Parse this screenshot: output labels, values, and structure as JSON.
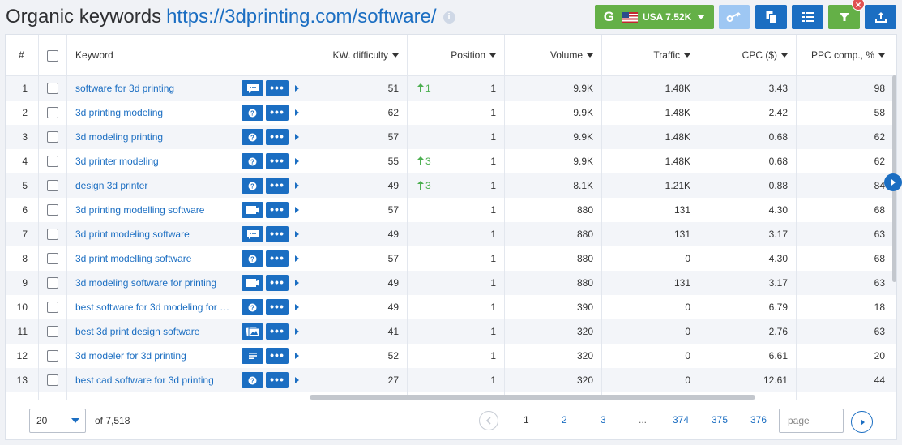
{
  "header": {
    "title": "Organic keywords",
    "url": "https://3dprinting.com/software/",
    "info_icon": "i",
    "database_label": "USA 7.52K",
    "database_g": "G"
  },
  "table": {
    "columns": {
      "index": "#",
      "keyword": "Keyword",
      "kd": "KW. difficulty",
      "position": "Position",
      "volume": "Volume",
      "traffic": "Traffic",
      "cpc": "CPC ($)",
      "ppc": "PPC comp., %"
    },
    "rows": [
      {
        "n": "1",
        "keyword": "software for 3d printing",
        "serp": "chat-bubble-icon",
        "kd": "51",
        "change": "1",
        "position": "1",
        "volume": "9.9K",
        "traffic": "1.48K",
        "cpc": "3.43",
        "ppc": "98"
      },
      {
        "n": "2",
        "keyword": "3d printing modeling",
        "serp": "question-icon",
        "kd": "62",
        "change": "",
        "position": "1",
        "volume": "9.9K",
        "traffic": "1.48K",
        "cpc": "2.42",
        "ppc": "58"
      },
      {
        "n": "3",
        "keyword": "3d modeling printing",
        "serp": "question-icon",
        "kd": "57",
        "change": "",
        "position": "1",
        "volume": "9.9K",
        "traffic": "1.48K",
        "cpc": "0.68",
        "ppc": "62"
      },
      {
        "n": "4",
        "keyword": "3d printer modeling",
        "serp": "question-icon",
        "kd": "55",
        "change": "3",
        "position": "1",
        "volume": "9.9K",
        "traffic": "1.48K",
        "cpc": "0.68",
        "ppc": "62"
      },
      {
        "n": "5",
        "keyword": "design 3d printer",
        "serp": "question-icon",
        "kd": "49",
        "change": "3",
        "position": "1",
        "volume": "8.1K",
        "traffic": "1.21K",
        "cpc": "0.88",
        "ppc": "84"
      },
      {
        "n": "6",
        "keyword": "3d printing modelling software",
        "serp": "video-icon",
        "kd": "57",
        "change": "",
        "position": "1",
        "volume": "880",
        "traffic": "131",
        "cpc": "4.30",
        "ppc": "68"
      },
      {
        "n": "7",
        "keyword": "3d print modeling software",
        "serp": "chat-bubble-icon",
        "kd": "49",
        "change": "",
        "position": "1",
        "volume": "880",
        "traffic": "131",
        "cpc": "3.17",
        "ppc": "63"
      },
      {
        "n": "8",
        "keyword": "3d print modelling software",
        "serp": "question-icon",
        "kd": "57",
        "change": "",
        "position": "1",
        "volume": "880",
        "traffic": "0",
        "cpc": "4.30",
        "ppc": "68"
      },
      {
        "n": "9",
        "keyword": "3d modeling software for printing",
        "serp": "video-icon",
        "kd": "49",
        "change": "",
        "position": "1",
        "volume": "880",
        "traffic": "131",
        "cpc": "3.17",
        "ppc": "63"
      },
      {
        "n": "10",
        "keyword": "best software for 3d modeling for …",
        "serp": "question-icon",
        "kd": "49",
        "change": "",
        "position": "1",
        "volume": "390",
        "traffic": "0",
        "cpc": "6.79",
        "ppc": "18"
      },
      {
        "n": "11",
        "keyword": "best 3d print design software",
        "serp": "image-pack-icon",
        "kd": "41",
        "change": "",
        "position": "1",
        "volume": "320",
        "traffic": "0",
        "cpc": "2.76",
        "ppc": "63"
      },
      {
        "n": "12",
        "keyword": "3d modeler for 3d printing",
        "serp": "text-lines-icon",
        "kd": "52",
        "change": "",
        "position": "1",
        "volume": "320",
        "traffic": "0",
        "cpc": "6.61",
        "ppc": "20"
      },
      {
        "n": "13",
        "keyword": "best cad software for 3d printing",
        "serp": "question-icon",
        "kd": "27",
        "change": "",
        "position": "1",
        "volume": "320",
        "traffic": "0",
        "cpc": "12.61",
        "ppc": "44"
      }
    ],
    "more_label": "•••"
  },
  "footer": {
    "per_page": "20",
    "total": "of 7,518",
    "pages": [
      "1",
      "2",
      "3",
      "...",
      "374",
      "375",
      "376"
    ],
    "page_placeholder": "page"
  },
  "colors": {
    "primary": "#1b6ec2",
    "green": "#64b047",
    "up_arrow": "#4caf50"
  }
}
